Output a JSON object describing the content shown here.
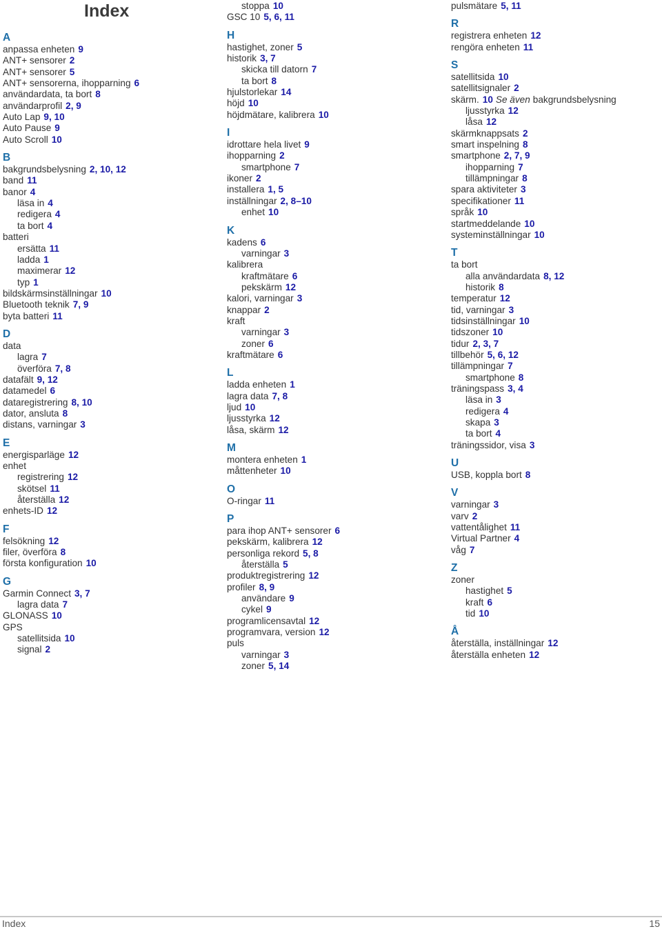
{
  "page": {
    "title": "Index",
    "footer_label": "Index",
    "page_number": "15"
  },
  "colors": {
    "letter_heading": "#1e6fa8",
    "page_reference": "#1a1aa6",
    "text": "#333333"
  },
  "columns": [
    {
      "sections": [
        {
          "letter": "A",
          "entries": [
            {
              "term": "anpassa enheten",
              "pages": "9",
              "level": 0
            },
            {
              "term": "ANT+ sensorer",
              "pages": "2",
              "level": 0
            },
            {
              "term": "ANT+ sensorer",
              "pages": "5",
              "level": 0
            },
            {
              "term": "ANT+ sensorerna, ihopparning",
              "pages": "6",
              "level": 0
            },
            {
              "term": "användardata, ta bort",
              "pages": "8",
              "level": 0
            },
            {
              "term": "användarprofil",
              "pages": "2, 9",
              "level": 0
            },
            {
              "term": "Auto Lap",
              "pages": "9, 10",
              "level": 0
            },
            {
              "term": "Auto Pause",
              "pages": "9",
              "level": 0
            },
            {
              "term": "Auto Scroll",
              "pages": "10",
              "level": 0
            }
          ]
        },
        {
          "letter": "B",
          "entries": [
            {
              "term": "bakgrundsbelysning",
              "pages": "2, 10, 12",
              "level": 0
            },
            {
              "term": "band",
              "pages": "11",
              "level": 0
            },
            {
              "term": "banor",
              "pages": "4",
              "level": 0
            },
            {
              "term": "läsa in",
              "pages": "4",
              "level": 1
            },
            {
              "term": "redigera",
              "pages": "4",
              "level": 1
            },
            {
              "term": "ta bort",
              "pages": "4",
              "level": 1
            },
            {
              "term": "batteri",
              "pages": "",
              "level": 0
            },
            {
              "term": "ersätta",
              "pages": "11",
              "level": 1
            },
            {
              "term": "ladda",
              "pages": "1",
              "level": 1
            },
            {
              "term": "maximerar",
              "pages": "12",
              "level": 1
            },
            {
              "term": "typ",
              "pages": "1",
              "level": 1
            },
            {
              "term": "bildskärmsinställningar",
              "pages": "10",
              "level": 0
            },
            {
              "term": "Bluetooth teknik",
              "pages": "7, 9",
              "level": 0
            },
            {
              "term": "byta batteri",
              "pages": "11",
              "level": 0
            }
          ]
        },
        {
          "letter": "D",
          "entries": [
            {
              "term": "data",
              "pages": "",
              "level": 0
            },
            {
              "term": "lagra",
              "pages": "7",
              "level": 1
            },
            {
              "term": "överföra",
              "pages": "7, 8",
              "level": 1
            },
            {
              "term": "datafält",
              "pages": "9, 12",
              "level": 0
            },
            {
              "term": "datamedel",
              "pages": "6",
              "level": 0
            },
            {
              "term": "dataregistrering",
              "pages": "8, 10",
              "level": 0
            },
            {
              "term": "dator, ansluta",
              "pages": "8",
              "level": 0
            },
            {
              "term": "distans, varningar",
              "pages": "3",
              "level": 0
            }
          ]
        },
        {
          "letter": "E",
          "entries": [
            {
              "term": "energisparläge",
              "pages": "12",
              "level": 0
            },
            {
              "term": "enhet",
              "pages": "",
              "level": 0
            },
            {
              "term": "registrering",
              "pages": "12",
              "level": 1
            },
            {
              "term": "skötsel",
              "pages": "11",
              "level": 1
            },
            {
              "term": "återställa",
              "pages": "12",
              "level": 1
            },
            {
              "term": "enhets-ID",
              "pages": "12",
              "level": 0
            }
          ]
        },
        {
          "letter": "F",
          "entries": [
            {
              "term": "felsökning",
              "pages": "12",
              "level": 0
            },
            {
              "term": "filer, överföra",
              "pages": "8",
              "level": 0
            },
            {
              "term": "första konfiguration",
              "pages": "10",
              "level": 0
            }
          ]
        },
        {
          "letter": "G",
          "entries": [
            {
              "term": "Garmin Connect",
              "pages": "3, 7",
              "level": 0
            },
            {
              "term": "lagra data",
              "pages": "7",
              "level": 1
            },
            {
              "term": "GLONASS",
              "pages": "10",
              "level": 0
            },
            {
              "term": "GPS",
              "pages": "",
              "level": 0
            },
            {
              "term": "satellitsida",
              "pages": "10",
              "level": 1
            },
            {
              "term": "signal",
              "pages": "2",
              "level": 1
            }
          ]
        }
      ]
    },
    {
      "sections": [
        {
          "letter": "",
          "entries": [
            {
              "term": "stoppa",
              "pages": "10",
              "level": 1
            },
            {
              "term": "GSC 10",
              "pages": "5, 6, 11",
              "level": 0
            }
          ]
        },
        {
          "letter": "H",
          "entries": [
            {
              "term": "hastighet, zoner",
              "pages": "5",
              "level": 0
            },
            {
              "term": "historik",
              "pages": "3, 7",
              "level": 0
            },
            {
              "term": "skicka till datorn",
              "pages": "7",
              "level": 1
            },
            {
              "term": "ta bort",
              "pages": "8",
              "level": 1
            },
            {
              "term": "hjulstorlekar",
              "pages": "14",
              "level": 0
            },
            {
              "term": "höjd",
              "pages": "10",
              "level": 0
            },
            {
              "term": "höjdmätare, kalibrera",
              "pages": "10",
              "level": 0
            }
          ]
        },
        {
          "letter": "I",
          "entries": [
            {
              "term": "idrottare hela livet",
              "pages": "9",
              "level": 0
            },
            {
              "term": "ihopparning",
              "pages": "2",
              "level": 0
            },
            {
              "term": "smartphone",
              "pages": "7",
              "level": 1
            },
            {
              "term": "ikoner",
              "pages": "2",
              "level": 0
            },
            {
              "term": "installera",
              "pages": "1, 5",
              "level": 0
            },
            {
              "term": "inställningar",
              "pages": "2, 8–10",
              "level": 0
            },
            {
              "term": "enhet",
              "pages": "10",
              "level": 1
            }
          ]
        },
        {
          "letter": "K",
          "entries": [
            {
              "term": "kadens",
              "pages": "6",
              "level": 0
            },
            {
              "term": "varningar",
              "pages": "3",
              "level": 1
            },
            {
              "term": "kalibrera",
              "pages": "",
              "level": 0
            },
            {
              "term": "kraftmätare",
              "pages": "6",
              "level": 1
            },
            {
              "term": "pekskärm",
              "pages": "12",
              "level": 1
            },
            {
              "term": "kalori, varningar",
              "pages": "3",
              "level": 0
            },
            {
              "term": "knappar",
              "pages": "2",
              "level": 0
            },
            {
              "term": "kraft",
              "pages": "",
              "level": 0
            },
            {
              "term": "varningar",
              "pages": "3",
              "level": 1
            },
            {
              "term": "zoner",
              "pages": "6",
              "level": 1
            },
            {
              "term": "kraftmätare",
              "pages": "6",
              "level": 0
            }
          ]
        },
        {
          "letter": "L",
          "entries": [
            {
              "term": "ladda enheten",
              "pages": "1",
              "level": 0
            },
            {
              "term": "lagra data",
              "pages": "7, 8",
              "level": 0
            },
            {
              "term": "ljud",
              "pages": "10",
              "level": 0
            },
            {
              "term": "ljusstyrka",
              "pages": "12",
              "level": 0
            },
            {
              "term": "låsa, skärm",
              "pages": "12",
              "level": 0
            }
          ]
        },
        {
          "letter": "M",
          "entries": [
            {
              "term": "montera enheten",
              "pages": "1",
              "level": 0
            },
            {
              "term": "måttenheter",
              "pages": "10",
              "level": 0
            }
          ]
        },
        {
          "letter": "O",
          "entries": [
            {
              "term": "O-ringar",
              "pages": "11",
              "level": 0
            }
          ]
        },
        {
          "letter": "P",
          "entries": [
            {
              "term": "para ihop ANT+ sensorer",
              "pages": "6",
              "level": 0
            },
            {
              "term": "pekskärm, kalibrera",
              "pages": "12",
              "level": 0
            },
            {
              "term": "personliga rekord",
              "pages": "5, 8",
              "level": 0
            },
            {
              "term": "återställa",
              "pages": "5",
              "level": 1
            },
            {
              "term": "produktregistrering",
              "pages": "12",
              "level": 0
            },
            {
              "term": "profiler",
              "pages": "8, 9",
              "level": 0
            },
            {
              "term": "användare",
              "pages": "9",
              "level": 1
            },
            {
              "term": "cykel",
              "pages": "9",
              "level": 1
            },
            {
              "term": "programlicensavtal",
              "pages": "12",
              "level": 0
            },
            {
              "term": "programvara, version",
              "pages": "12",
              "level": 0
            },
            {
              "term": "puls",
              "pages": "",
              "level": 0
            },
            {
              "term": "varningar",
              "pages": "3",
              "level": 1
            },
            {
              "term": "zoner",
              "pages": "5, 14",
              "level": 1
            }
          ]
        }
      ]
    },
    {
      "sections": [
        {
          "letter": "",
          "entries": [
            {
              "term": "pulsmätare",
              "pages": "5, 11",
              "level": 0
            }
          ]
        },
        {
          "letter": "R",
          "entries": [
            {
              "term": "registrera enheten",
              "pages": "12",
              "level": 0
            },
            {
              "term": "rengöra enheten",
              "pages": "11",
              "level": 0
            }
          ]
        },
        {
          "letter": "S",
          "entries": [
            {
              "term": "satellitsida",
              "pages": "10",
              "level": 0
            },
            {
              "term": "satellitsignaler",
              "pages": "2",
              "level": 0
            },
            {
              "term": "skärm.",
              "pages": "10",
              "level": 0,
              "see_also": "Se även",
              "see_target": "bakgrundsbelysning"
            },
            {
              "term": "ljusstyrka",
              "pages": "12",
              "level": 1
            },
            {
              "term": "låsa",
              "pages": "12",
              "level": 1
            },
            {
              "term": "skärmknappsats",
              "pages": "2",
              "level": 0
            },
            {
              "term": "smart inspelning",
              "pages": "8",
              "level": 0
            },
            {
              "term": "smartphone",
              "pages": "2, 7, 9",
              "level": 0
            },
            {
              "term": "ihopparning",
              "pages": "7",
              "level": 1
            },
            {
              "term": "tillämpningar",
              "pages": "8",
              "level": 1
            },
            {
              "term": "spara aktiviteter",
              "pages": "3",
              "level": 0
            },
            {
              "term": "specifikationer",
              "pages": "11",
              "level": 0
            },
            {
              "term": "språk",
              "pages": "10",
              "level": 0
            },
            {
              "term": "startmeddelande",
              "pages": "10",
              "level": 0
            },
            {
              "term": "systeminställningar",
              "pages": "10",
              "level": 0
            }
          ]
        },
        {
          "letter": "T",
          "entries": [
            {
              "term": "ta bort",
              "pages": "",
              "level": 0
            },
            {
              "term": "alla användardata",
              "pages": "8, 12",
              "level": 1
            },
            {
              "term": "historik",
              "pages": "8",
              "level": 1
            },
            {
              "term": "temperatur",
              "pages": "12",
              "level": 0
            },
            {
              "term": "tid, varningar",
              "pages": "3",
              "level": 0
            },
            {
              "term": "tidsinställningar",
              "pages": "10",
              "level": 0
            },
            {
              "term": "tidszoner",
              "pages": "10",
              "level": 0
            },
            {
              "term": "tidur",
              "pages": "2, 3, 7",
              "level": 0
            },
            {
              "term": "tillbehör",
              "pages": "5, 6, 12",
              "level": 0
            },
            {
              "term": "tillämpningar",
              "pages": "7",
              "level": 0
            },
            {
              "term": "smartphone",
              "pages": "8",
              "level": 1
            },
            {
              "term": "träningspass",
              "pages": "3, 4",
              "level": 0
            },
            {
              "term": "läsa in",
              "pages": "3",
              "level": 1
            },
            {
              "term": "redigera",
              "pages": "4",
              "level": 1
            },
            {
              "term": "skapa",
              "pages": "3",
              "level": 1
            },
            {
              "term": "ta bort",
              "pages": "4",
              "level": 1
            },
            {
              "term": "träningssidor, visa",
              "pages": "3",
              "level": 0
            }
          ]
        },
        {
          "letter": "U",
          "entries": [
            {
              "term": "USB, koppla bort",
              "pages": "8",
              "level": 0
            }
          ]
        },
        {
          "letter": "V",
          "entries": [
            {
              "term": "varningar",
              "pages": "3",
              "level": 0
            },
            {
              "term": "varv",
              "pages": "2",
              "level": 0
            },
            {
              "term": "vattentålighet",
              "pages": "11",
              "level": 0
            },
            {
              "term": "Virtual Partner",
              "pages": "4",
              "level": 0
            },
            {
              "term": "våg",
              "pages": "7",
              "level": 0
            }
          ]
        },
        {
          "letter": "Z",
          "entries": [
            {
              "term": "zoner",
              "pages": "",
              "level": 0
            },
            {
              "term": "hastighet",
              "pages": "5",
              "level": 1
            },
            {
              "term": "kraft",
              "pages": "6",
              "level": 1
            },
            {
              "term": "tid",
              "pages": "10",
              "level": 1
            }
          ]
        },
        {
          "letter": "Å",
          "entries": [
            {
              "term": "återställa, inställningar",
              "pages": "12",
              "level": 0
            },
            {
              "term": "återställa enheten",
              "pages": "12",
              "level": 0
            }
          ]
        }
      ]
    }
  ]
}
